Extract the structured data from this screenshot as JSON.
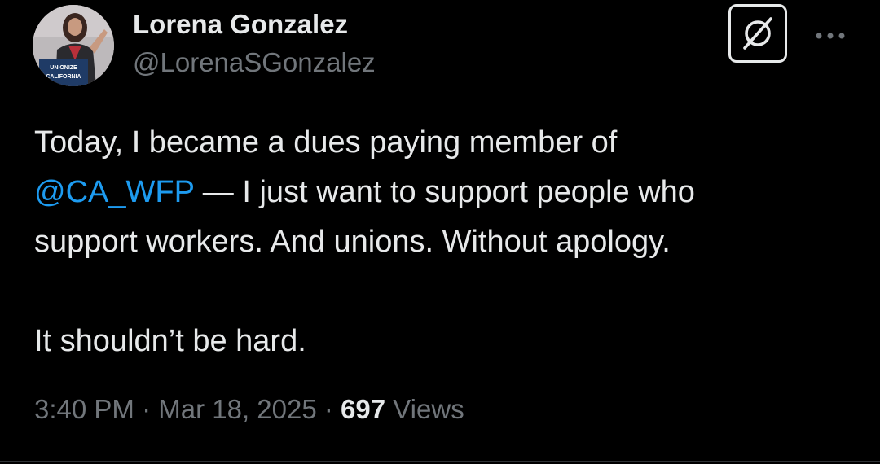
{
  "author": {
    "name": "Lorena Gonzalez",
    "handle": "@LorenaSGonzalez",
    "avatar_icon": "profile-photo",
    "avatar_sign_text": "UNIONIZE CALIFORNIA"
  },
  "actions": {
    "grok_icon": "grok-icon",
    "more_icon": "more-dots-icon"
  },
  "tweet": {
    "line1": "Today, I became a dues paying member of",
    "mention": "@CA_WFP",
    "line2_rest": " — I just want to support people who",
    "line3": "support workers. And unions. Without apology.",
    "line4": "It shouldn’t be hard."
  },
  "meta": {
    "time": "3:40 PM",
    "separator": " · ",
    "date": "Mar 18, 2025",
    "views_count": "697",
    "views_label": " Views"
  },
  "colors": {
    "background": "#000000",
    "text": "#e7e9ea",
    "secondary": "#71767b",
    "link": "#1d9bf0"
  }
}
